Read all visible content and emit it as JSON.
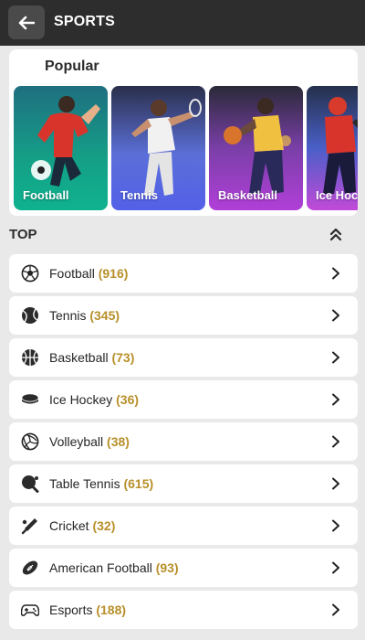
{
  "header": {
    "title": "SPORTS",
    "back_icon": "arrow-left-icon"
  },
  "popular": {
    "title": "Popular",
    "tiles": [
      {
        "label": "Football"
      },
      {
        "label": "Tennis"
      },
      {
        "label": "Basketball"
      },
      {
        "label": "Ice Hockey"
      }
    ]
  },
  "top": {
    "title": "TOP",
    "collapse_icon": "chevron-double-up-icon",
    "items": [
      {
        "label": "Football",
        "count": "(916)",
        "icon": "soccer-ball-icon"
      },
      {
        "label": "Tennis",
        "count": "(345)",
        "icon": "tennis-ball-icon"
      },
      {
        "label": "Basketball",
        "count": "(73)",
        "icon": "basketball-icon"
      },
      {
        "label": "Ice Hockey",
        "count": "(36)",
        "icon": "hockey-puck-icon"
      },
      {
        "label": "Volleyball",
        "count": "(38)",
        "icon": "volleyball-icon"
      },
      {
        "label": "Table Tennis",
        "count": "(615)",
        "icon": "ping-pong-paddle-icon"
      },
      {
        "label": "Cricket",
        "count": "(32)",
        "icon": "cricket-bat-icon"
      },
      {
        "label": "American Football",
        "count": "(93)",
        "icon": "american-football-icon"
      },
      {
        "label": "Esports",
        "count": "(188)",
        "icon": "gamepad-icon"
      }
    ]
  },
  "colors": {
    "header_bg": "#2d2d2d",
    "count_accent": "#b8902a",
    "page_bg": "#e9e9e9"
  }
}
